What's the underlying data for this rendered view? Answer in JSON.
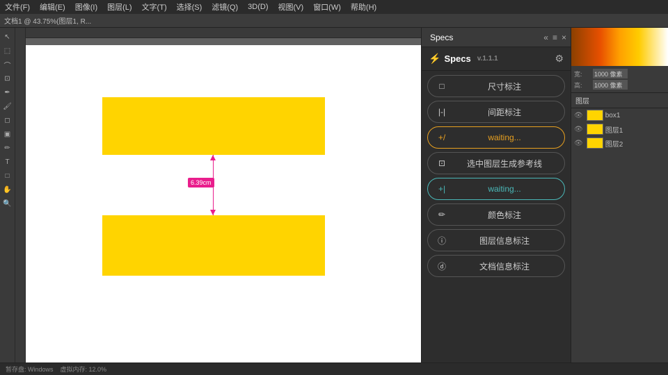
{
  "menubar": {
    "items": [
      "文件(F)",
      "编辑(E)",
      "图像(I)",
      "图层(L)",
      "文字(T)",
      "选择(S)",
      "滤镜(Q)",
      "3D(D)",
      "视图(V)",
      "窗口(W)",
      "帮助(H)"
    ]
  },
  "toolbar": {
    "items": [
      "文档",
      "文档1 @ 43.75%(图层1, R..."
    ]
  },
  "specs_panel": {
    "tab_label": "Specs",
    "back_icon": "«",
    "close_icon": "×",
    "menu_icon": "≡",
    "title": "Specs",
    "title_icon": "⚡",
    "version": "v.1.1.1",
    "gear_icon": "⚙",
    "buttons": [
      {
        "id": "size-annotation",
        "icon": "□",
        "label": "尺寸标注",
        "style": "normal"
      },
      {
        "id": "spacing-annotation",
        "icon": "|-|",
        "label": "间距标注",
        "style": "normal"
      },
      {
        "id": "waiting1",
        "icon": "+/",
        "label": "waiting...",
        "style": "waiting"
      },
      {
        "id": "generate-guide",
        "icon": "⊡",
        "label": "选中图层生成参考线",
        "style": "normal"
      },
      {
        "id": "waiting2",
        "icon": "+|",
        "label": "waiting...",
        "style": "waiting-teal"
      },
      {
        "id": "color-annotation",
        "icon": "✏",
        "label": "颜色标注",
        "style": "normal"
      },
      {
        "id": "layer-info",
        "icon": "ⓘ",
        "label": "图层信息标注",
        "style": "normal"
      },
      {
        "id": "doc-info",
        "icon": "ⓓ",
        "label": "文档信息标注",
        "style": "normal"
      }
    ]
  },
  "measurement": {
    "label": "6.39cm"
  },
  "layers": {
    "header": "图层",
    "items": [
      {
        "name": "box1",
        "visible": true
      },
      {
        "name": "图层1",
        "visible": true
      },
      {
        "name": "图层2",
        "visible": true
      }
    ]
  },
  "status": {
    "text": "暂存盘: Windows",
    "text2": "虚拟内存: 12.0%"
  }
}
